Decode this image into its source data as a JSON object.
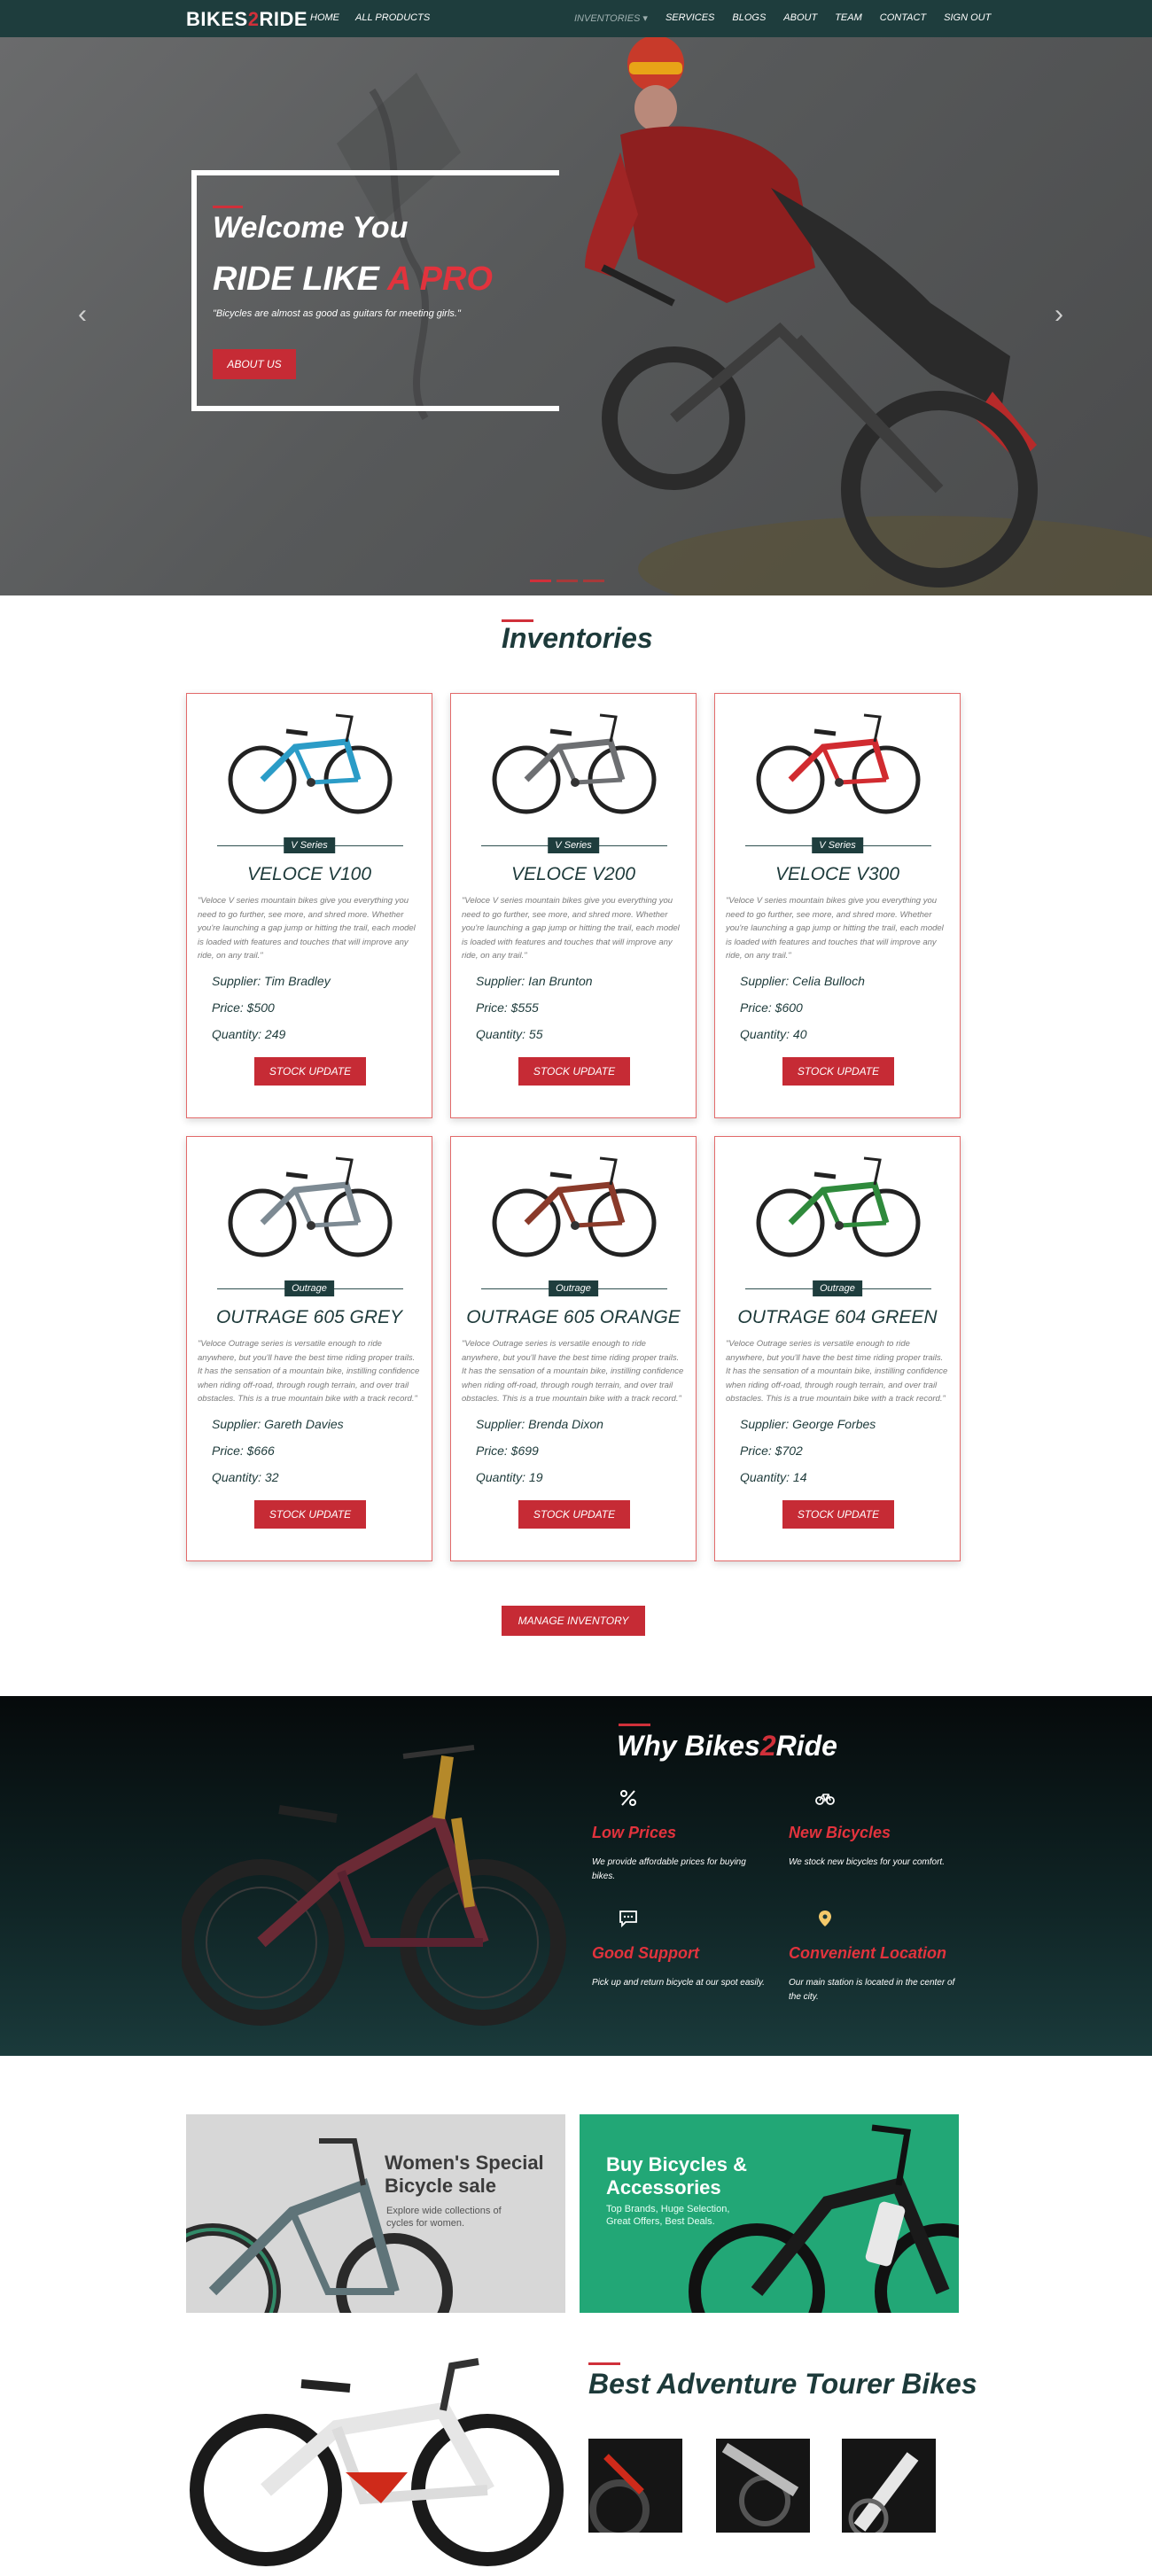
{
  "nav": {
    "brand_prefix": "BIKES",
    "brand_two": "2",
    "brand_suffix": "RIDE",
    "left_links": [
      "HOME",
      "ALL PRODUCTS"
    ],
    "inventories_label": "INVENTORIES ▾",
    "right_links": [
      "SERVICES",
      "BLOGS",
      "ABOUT",
      "TEAM",
      "CONTACT",
      "SIGN OUT"
    ]
  },
  "hero": {
    "welcome": "Welcome You",
    "ride_prefix": "RIDE LIKE",
    "ride_highlight": " A PRO",
    "quote": "\"Bicycles are almost as good as guitars for meeting girls.\"",
    "button": "ABOUT US",
    "prev": "‹",
    "next": "›"
  },
  "inventories": {
    "title": "Inventories",
    "button_label": "STOCK UPDATE",
    "manage_label": "MANAGE INVENTORY",
    "items": [
      {
        "tag": "V Series",
        "name": "VELOCE V100",
        "desc": "\"Veloce V series mountain bikes give you everything you need to go further, see more, and shred more. Whether you're launching a gap jump or hitting the trail, each model is loaded with features and touches that will improve any ride, on any trail.\"",
        "supplier": "Supplier: Tim Bradley",
        "price": "Price: $500",
        "quantity": "Quantity: 249",
        "color": "#2b9cc7"
      },
      {
        "tag": "V Series",
        "name": "VELOCE V200",
        "desc": "\"Veloce V series mountain bikes give you everything you need to go further, see more, and shred more. Whether you're launching a gap jump or hitting the trail, each model is loaded with features and touches that will improve any ride, on any trail.\"",
        "supplier": "Supplier: Ian Brunton",
        "price": "Price: $555",
        "quantity": "Quantity: 55",
        "color": "#6d6f72"
      },
      {
        "tag": "V Series",
        "name": "VELOCE V300",
        "desc": "\"Veloce V series mountain bikes give you everything you need to go further, see more, and shred more. Whether you're launching a gap jump or hitting the trail, each model is loaded with features and touches that will improve any ride, on any trail.\"",
        "supplier": "Supplier: Celia Bulloch",
        "price": "Price: $600",
        "quantity": "Quantity: 40",
        "color": "#d12b30"
      },
      {
        "tag": "Outrage",
        "name": "OUTRAGE 605 GREY",
        "desc": "\"Veloce Outrage series is versatile enough to ride anywhere, but you'll have the best time riding proper trails. It has the sensation of a mountain bike, instilling confidence when riding off-road, through rough terrain, and over trail obstacles. This is a true mountain bike with a track record.\"",
        "supplier": "Supplier: Gareth Davies",
        "price": "Price: $666",
        "quantity": "Quantity: 32",
        "color": "#7d8a93"
      },
      {
        "tag": "Outrage",
        "name": "OUTRAGE 605 ORANGE",
        "desc": "\"Veloce Outrage series is versatile enough to ride anywhere, but you'll have the best time riding proper trails. It has the sensation of a mountain bike, instilling confidence when riding off-road, through rough terrain, and over trail obstacles. This is a true mountain bike with a track record.\"",
        "supplier": "Supplier: Brenda Dixon",
        "price": "Price: $699",
        "quantity": "Quantity: 19",
        "color": "#8a3a2a"
      },
      {
        "tag": "Outrage",
        "name": "OUTRAGE 604 GREEN",
        "desc": "\"Veloce Outrage series is versatile enough to ride anywhere, but you'll have the best time riding proper trails. It has the sensation of a mountain bike, instilling confidence when riding off-road, through rough terrain, and over trail obstacles. This is a true mountain bike with a track record.\"",
        "supplier": "Supplier: George Forbes",
        "price": "Price: $702",
        "quantity": "Quantity: 14",
        "color": "#2f8a3c"
      }
    ]
  },
  "why": {
    "title_prefix": "Why Bikes",
    "title_two": "2",
    "title_suffix": "Ride",
    "features": [
      {
        "icon": "percent-icon",
        "title": "Low Prices",
        "text": "We provide affordable prices for buying bikes."
      },
      {
        "icon": "bicycle-icon",
        "title": "New Bicycles",
        "text": "We stock new bicycles for your comfort."
      },
      {
        "icon": "chat-icon",
        "title": "Good Support",
        "text": "Pick up and return bicycle at our spot easily."
      },
      {
        "icon": "location-pin-icon",
        "title": "Convenient Location",
        "text": "Our main station is located in the center of the city."
      }
    ]
  },
  "promos": {
    "women_title_1": "Women's Special",
    "women_title_2": "Bicycle sale",
    "women_sub_1": "Explore wide collections of",
    "women_sub_2": "cycles for women.",
    "buy_title_1": "Buy Bicycles &",
    "buy_title_2": "Accessories",
    "buy_sub_1": "Top Brands, Huge Selection,",
    "buy_sub_2": "Great Offers, Best Deals."
  },
  "adventure": {
    "title": "Best Adventure Tourer Bikes"
  },
  "colors": {
    "nav_bg": "#1e3d3d",
    "accent_red": "#c62b35",
    "promo_green": "#22a776"
  }
}
